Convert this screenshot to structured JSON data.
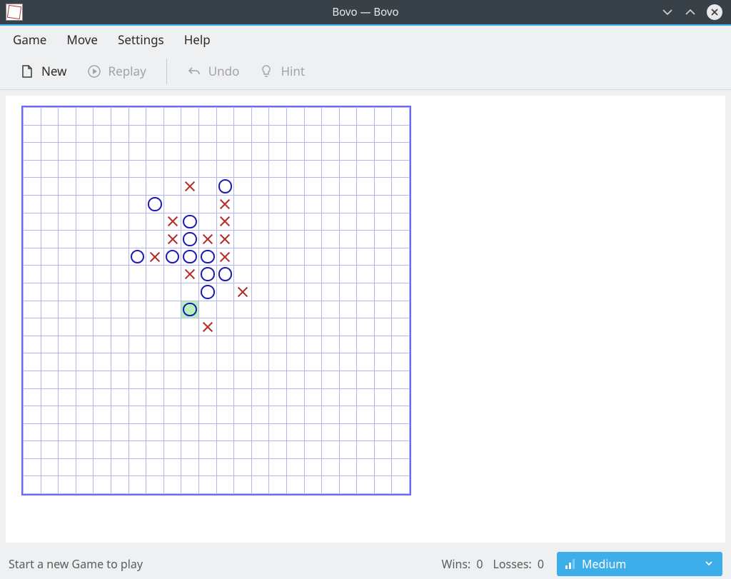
{
  "window": {
    "title": "Bovo — Bovo"
  },
  "menubar": {
    "items": [
      "Game",
      "Move",
      "Settings",
      "Help"
    ]
  },
  "toolbar": {
    "new": {
      "label": "New",
      "enabled": true
    },
    "replay": {
      "label": "Replay",
      "enabled": false
    },
    "undo": {
      "label": "Undo",
      "enabled": false
    },
    "hint": {
      "label": "Hint",
      "enabled": false
    }
  },
  "board": {
    "cols": 22,
    "rows": 22,
    "highlight": {
      "row": 11,
      "col": 9
    },
    "moves": [
      {
        "row": 4,
        "col": 9,
        "p": "x"
      },
      {
        "row": 4,
        "col": 11,
        "p": "o"
      },
      {
        "row": 5,
        "col": 7,
        "p": "o"
      },
      {
        "row": 5,
        "col": 11,
        "p": "x"
      },
      {
        "row": 6,
        "col": 8,
        "p": "x"
      },
      {
        "row": 6,
        "col": 9,
        "p": "o"
      },
      {
        "row": 6,
        "col": 11,
        "p": "x"
      },
      {
        "row": 7,
        "col": 8,
        "p": "x"
      },
      {
        "row": 7,
        "col": 9,
        "p": "o"
      },
      {
        "row": 7,
        "col": 10,
        "p": "x"
      },
      {
        "row": 7,
        "col": 11,
        "p": "x"
      },
      {
        "row": 8,
        "col": 6,
        "p": "o"
      },
      {
        "row": 8,
        "col": 7,
        "p": "x"
      },
      {
        "row": 8,
        "col": 8,
        "p": "o"
      },
      {
        "row": 8,
        "col": 9,
        "p": "o"
      },
      {
        "row": 8,
        "col": 10,
        "p": "o"
      },
      {
        "row": 8,
        "col": 11,
        "p": "x"
      },
      {
        "row": 9,
        "col": 9,
        "p": "x"
      },
      {
        "row": 9,
        "col": 10,
        "p": "o"
      },
      {
        "row": 9,
        "col": 11,
        "p": "o"
      },
      {
        "row": 10,
        "col": 10,
        "p": "o"
      },
      {
        "row": 10,
        "col": 12,
        "p": "x"
      },
      {
        "row": 11,
        "col": 9,
        "p": "o"
      },
      {
        "row": 12,
        "col": 10,
        "p": "x"
      }
    ]
  },
  "status": {
    "message": "Start a new Game to play",
    "wins_label": "Wins:",
    "wins": 0,
    "losses_label": "Losses:",
    "losses": 0
  },
  "difficulty": {
    "label": "Medium"
  }
}
